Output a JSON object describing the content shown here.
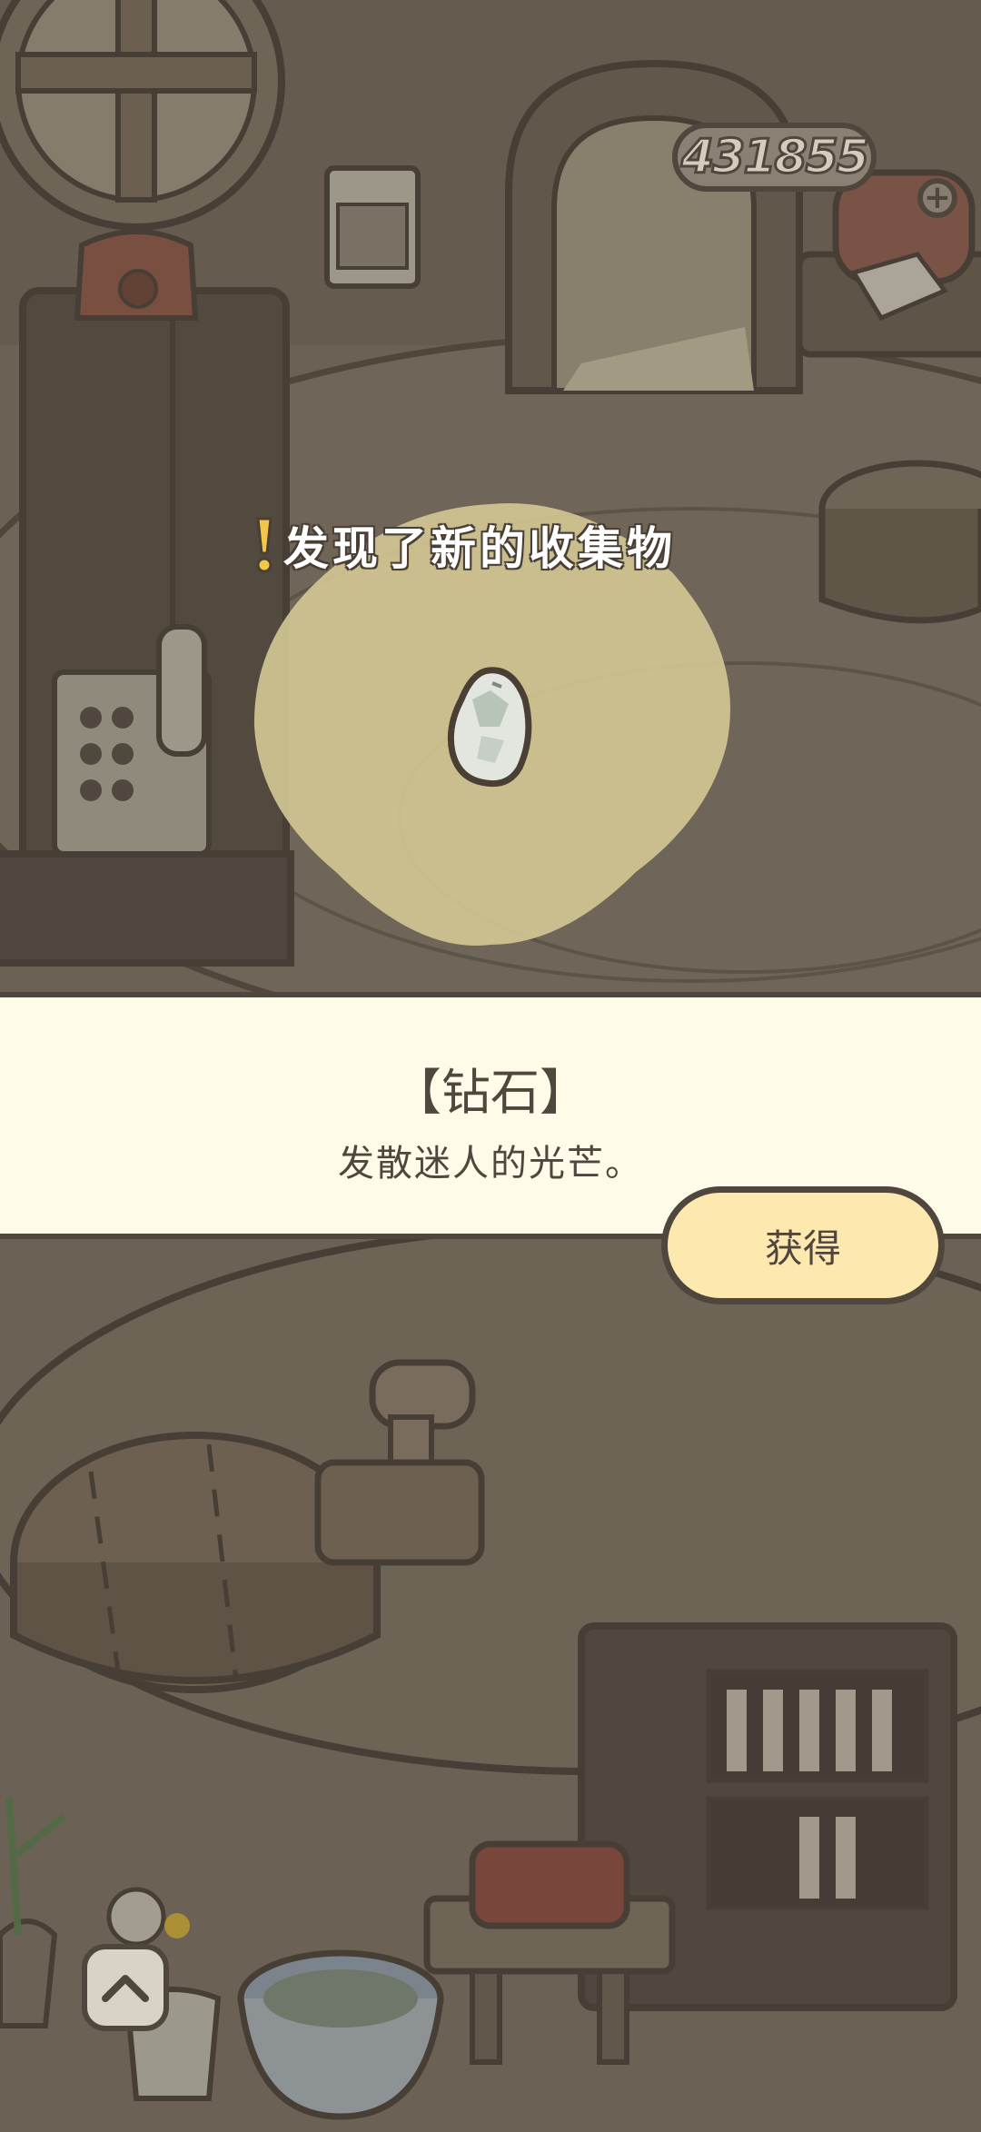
{
  "hud": {
    "coin_count": "431855",
    "plus_symbol": "+"
  },
  "discovery": {
    "headline": "发现了新的收集物",
    "icon": "exclamation-icon"
  },
  "item": {
    "name": "【钻石】",
    "description": "发散迷人的光芒。",
    "icon": "diamond-stone-icon"
  },
  "actions": {
    "get_label": "获得",
    "up_icon": "chevron-up-icon"
  },
  "colors": {
    "outline": "#4f463d",
    "panel_bg": "#fefbe8",
    "button_bg": "#fde9b0",
    "glow": "#f7eab0"
  }
}
